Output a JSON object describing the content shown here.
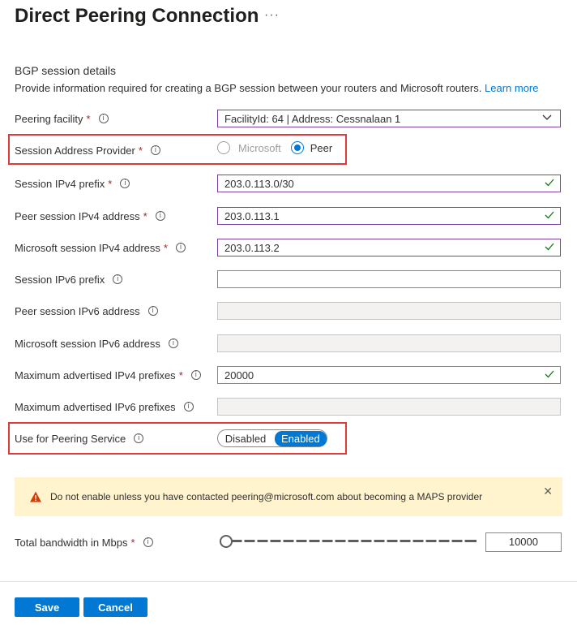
{
  "header": {
    "title": "Direct Peering Connection",
    "more": "···"
  },
  "section": {
    "title": "BGP session details",
    "description": "Provide information required for creating a BGP session between your routers and Microsoft routers.",
    "learn_more": "Learn more"
  },
  "fields": {
    "peering_facility": {
      "label": "Peering facility",
      "value": "FacilityId: 64 | Address: Cessnalaan 1"
    },
    "session_address_provider": {
      "label": "Session Address Provider",
      "option_microsoft": "Microsoft",
      "option_peer": "Peer",
      "selected": "Peer"
    },
    "session_ipv4_prefix": {
      "label": "Session IPv4 prefix",
      "value": "203.0.113.0/30"
    },
    "peer_session_ipv4": {
      "label": "Peer session IPv4 address",
      "value": "203.0.113.1"
    },
    "microsoft_session_ipv4": {
      "label": "Microsoft session IPv4 address",
      "value": "203.0.113.2"
    },
    "session_ipv6_prefix": {
      "label": "Session IPv6 prefix",
      "value": ""
    },
    "peer_session_ipv6": {
      "label": "Peer session IPv6 address",
      "value": ""
    },
    "microsoft_session_ipv6": {
      "label": "Microsoft session IPv6 address",
      "value": ""
    },
    "max_ipv4_prefixes": {
      "label": "Maximum advertised IPv4 prefixes",
      "value": "20000"
    },
    "max_ipv6_prefixes": {
      "label": "Maximum advertised IPv6 prefixes",
      "value": ""
    },
    "peering_service": {
      "label": "Use for Peering Service",
      "off_label": "Disabled",
      "on_label": "Enabled",
      "selected": "Enabled"
    },
    "bandwidth": {
      "label": "Total bandwidth in Mbps",
      "value": "10000"
    }
  },
  "warning": {
    "text": "Do not enable unless you have contacted peering@microsoft.com about becoming a MAPS provider"
  },
  "footer": {
    "save": "Save",
    "cancel": "Cancel"
  },
  "colors": {
    "accent": "#0078d4",
    "highlight": "#e03a3a",
    "valid": "#107c10",
    "warning_bg": "#fff4ce"
  }
}
